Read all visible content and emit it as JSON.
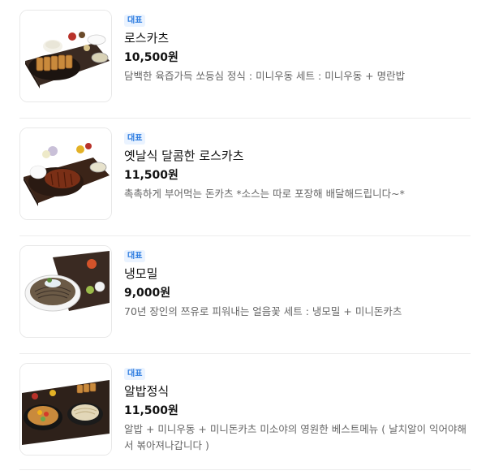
{
  "menu": {
    "items": [
      {
        "badge": "대표",
        "name": "로스카츠",
        "price": "10,500원",
        "description": "담백한 육즙가득 쏘등심 정식 : 미니우동 세트 : 미니우동 + 명란밥",
        "image_icon": "food-photo-icon"
      },
      {
        "badge": "대표",
        "name": "옛날식 달콤한 로스카츠",
        "price": "11,500원",
        "description": "촉촉하게 부어먹는 돈카츠 *소스는 따로 포장해 배달해드립니다~*",
        "image_icon": "food-photo-icon"
      },
      {
        "badge": "대표",
        "name": "냉모밀",
        "price": "9,000원",
        "description": "70년 장인의 쯔유로 피워내는 얼음꽃 세트 : 냉모밀 + 미니돈카츠",
        "image_icon": "food-photo-icon"
      },
      {
        "badge": "대표",
        "name": "알밥정식",
        "price": "11,500원",
        "description": "알밥 + 미니우동 + 미니돈카츠 미소야의 영원한 베스트메뉴 ( 날치알이 익어야해서 볶아져나갑니다 )",
        "image_icon": "food-photo-icon"
      }
    ]
  },
  "colors": {
    "badge_bg": "#eaf3ff",
    "badge_text": "#2d7ce0",
    "divider": "#ececec"
  }
}
